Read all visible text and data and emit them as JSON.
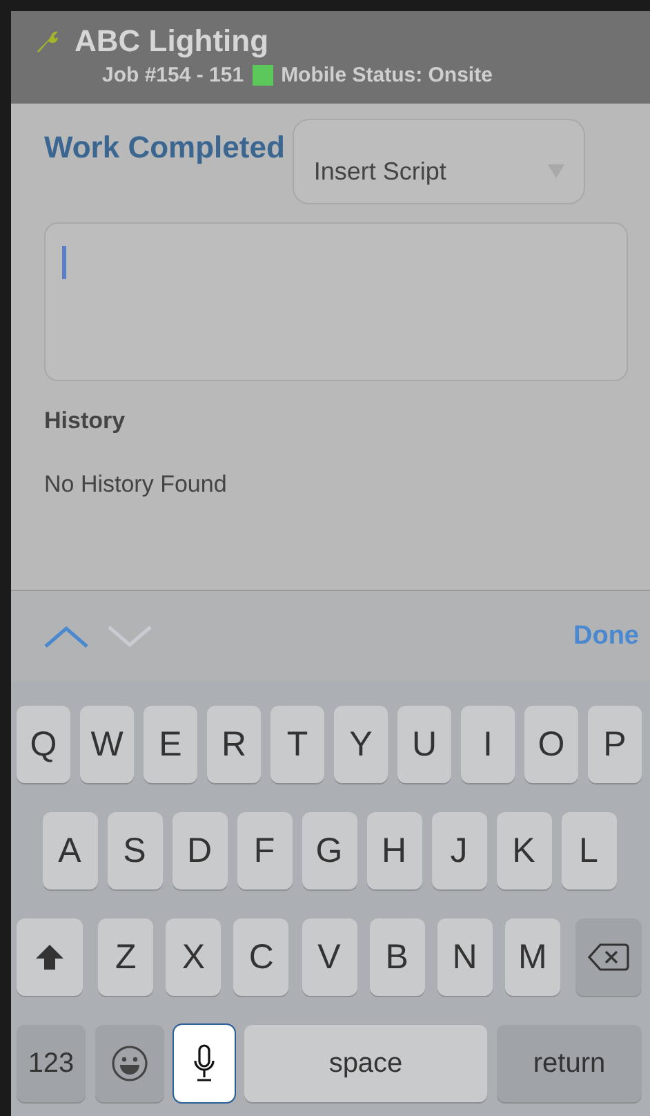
{
  "header": {
    "title": "ABC Lighting",
    "job": "Job #154 - 151",
    "mobile_status": {
      "label": "Mobile Status: Onsite",
      "color": "#5cc85c"
    }
  },
  "form": {
    "title": "Work Completed",
    "script_select": {
      "placeholder": "Insert Script"
    },
    "history_title": "History",
    "history_empty": "No History Found"
  },
  "accessory_bar": {
    "nav": [
      {
        "kind": "up",
        "disabled": false
      },
      {
        "kind": "down",
        "disabled": true
      }
    ],
    "done": "Done"
  },
  "keyboard": {
    "letter_rows": [
      {
        "keys": [
          {
            "kind": "letter",
            "label": "Q"
          },
          {
            "kind": "letter",
            "label": "W"
          },
          {
            "kind": "letter",
            "label": "E"
          },
          {
            "kind": "letter",
            "label": "R"
          },
          {
            "kind": "letter",
            "label": "T"
          },
          {
            "kind": "letter",
            "label": "Y"
          },
          {
            "kind": "letter",
            "label": "U"
          },
          {
            "kind": "letter",
            "label": "I"
          },
          {
            "kind": "letter",
            "label": "O"
          },
          {
            "kind": "letter",
            "label": "P"
          }
        ]
      },
      {
        "keys": [
          {
            "kind": "letter",
            "label": "A"
          },
          {
            "kind": "letter",
            "label": "S"
          },
          {
            "kind": "letter",
            "label": "D"
          },
          {
            "kind": "letter",
            "label": "F"
          },
          {
            "kind": "letter",
            "label": "G"
          },
          {
            "kind": "letter",
            "label": "H"
          },
          {
            "kind": "letter",
            "label": "J"
          },
          {
            "kind": "letter",
            "label": "K"
          },
          {
            "kind": "letter",
            "label": "L"
          }
        ]
      },
      {
        "keys": [
          {
            "kind": "shift"
          },
          {
            "kind": "letter",
            "label": "Z"
          },
          {
            "kind": "letter",
            "label": "X"
          },
          {
            "kind": "letter",
            "label": "C"
          },
          {
            "kind": "letter",
            "label": "V"
          },
          {
            "kind": "letter",
            "label": "B"
          },
          {
            "kind": "letter",
            "label": "N"
          },
          {
            "kind": "letter",
            "label": "M"
          },
          {
            "kind": "delete"
          }
        ]
      }
    ],
    "bottom_row": [
      {
        "kind": "numbers",
        "label": "123",
        "selected": false
      },
      {
        "kind": "emoji",
        "selected": false
      },
      {
        "kind": "mic",
        "selected": true
      },
      {
        "kind": "space",
        "label": "space",
        "selected": false
      },
      {
        "kind": "return",
        "label": "return",
        "selected": false
      }
    ]
  }
}
